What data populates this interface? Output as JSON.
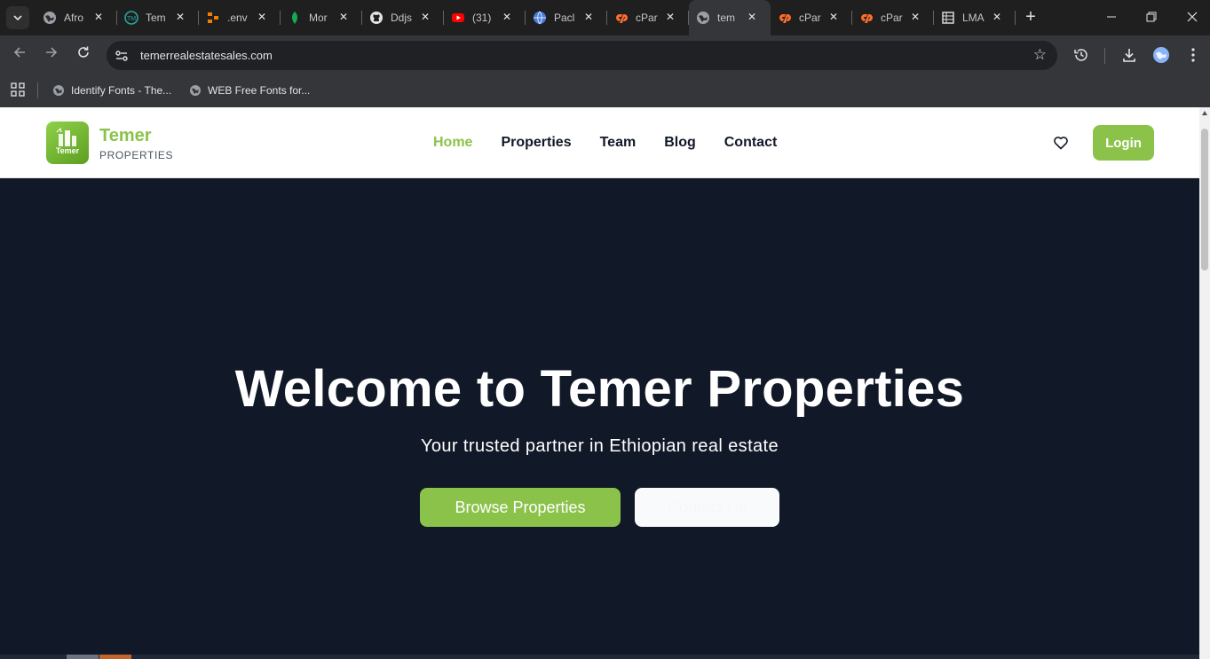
{
  "browser": {
    "tabs": [
      {
        "title": "Afro",
        "favicon": "globe-icon",
        "active": false
      },
      {
        "title": "Tem",
        "favicon": "tm-circle-icon",
        "active": false
      },
      {
        "title": ".env",
        "favicon": "orange-diagram-icon",
        "active": false
      },
      {
        "title": "Mor",
        "favicon": "leaf-icon",
        "active": false
      },
      {
        "title": "Ddjs",
        "favicon": "github-icon",
        "active": false
      },
      {
        "title": "(31)",
        "favicon": "youtube-icon",
        "active": false
      },
      {
        "title": "Pacl",
        "favicon": "blue-globe-icon",
        "active": false
      },
      {
        "title": "cPar",
        "favicon": "cpanel-icon",
        "active": false
      },
      {
        "title": "tem",
        "favicon": "globe-icon",
        "active": true
      },
      {
        "title": "cPar",
        "favicon": "cpanel-icon",
        "active": false
      },
      {
        "title": "cPar",
        "favicon": "cpanel-icon",
        "active": false
      },
      {
        "title": "LMA",
        "favicon": "sheet-icon",
        "active": false
      }
    ],
    "url": "temerrealestatesales.com",
    "bookmarks": [
      {
        "label": "Identify Fonts - The..."
      },
      {
        "label": "WEB Free Fonts for..."
      }
    ]
  },
  "site": {
    "brand": {
      "name": "Temer",
      "sub": "PROPERTIES",
      "logo_text": "Temer"
    },
    "nav": [
      {
        "label": "Home",
        "current": true
      },
      {
        "label": "Properties",
        "current": false
      },
      {
        "label": "Team",
        "current": false
      },
      {
        "label": "Blog",
        "current": false
      },
      {
        "label": "Contact",
        "current": false
      }
    ],
    "login_label": "Login",
    "hero": {
      "title": "Welcome to Temer Properties",
      "subtitle": "Your trusted partner in Ethiopian real estate",
      "browse_label": "Browse Properties",
      "contact_label": "Contact Us"
    }
  },
  "colors": {
    "accent": "#8bc34a",
    "hero_bg": "#111827",
    "chrome_bg": "#35363a"
  }
}
